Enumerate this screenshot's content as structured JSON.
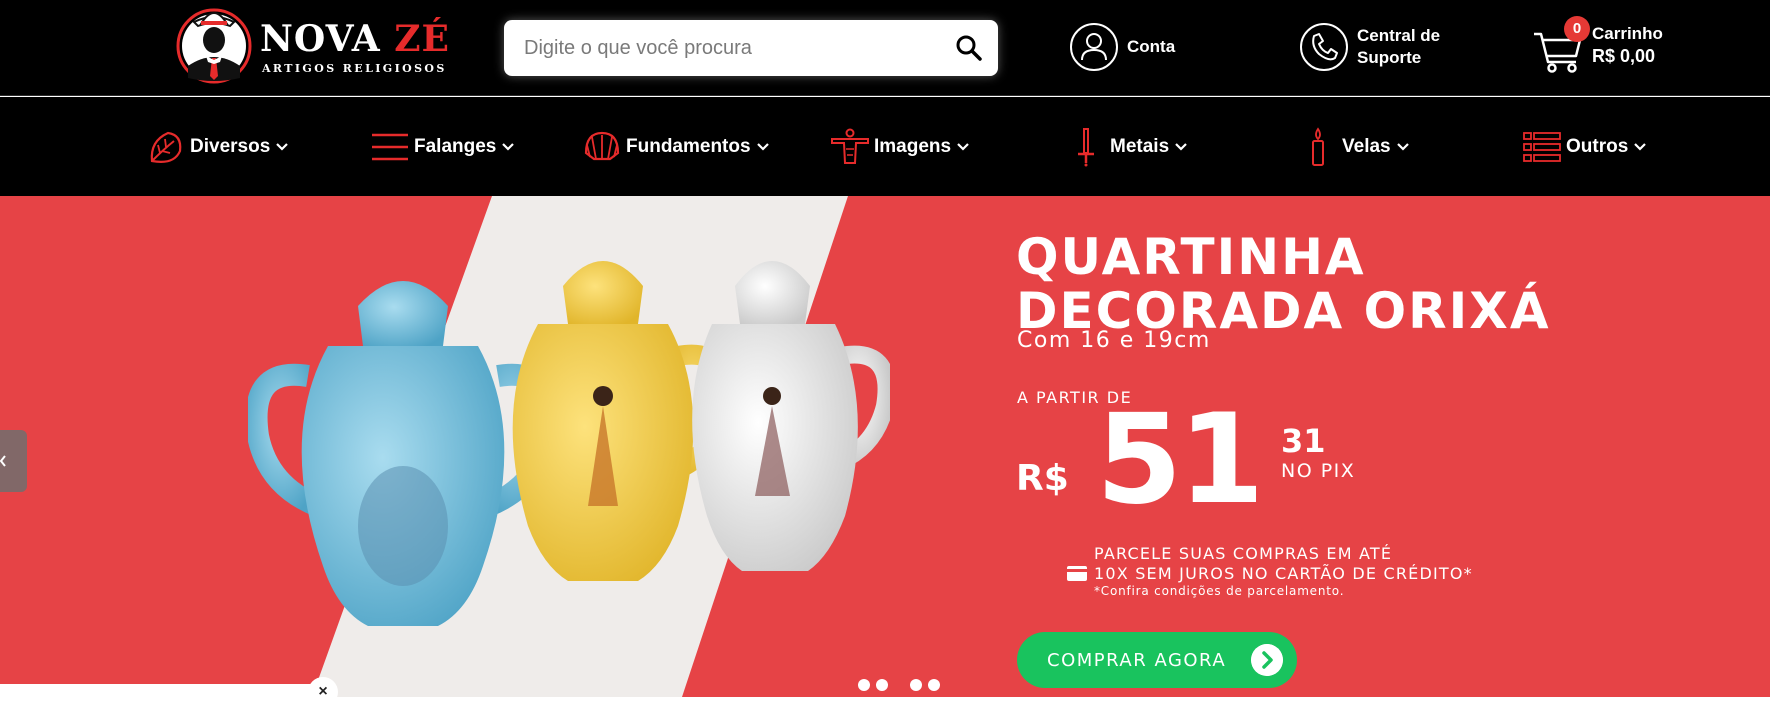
{
  "brand": {
    "name_main": "NOVA ",
    "name_accent": "ZÉ",
    "tagline": "ARTIGOS RELIGIOSOS"
  },
  "search": {
    "placeholder": "Digite o que você procura"
  },
  "header": {
    "account_label": "Conta",
    "support_line1": "Central de",
    "support_line2": "Suporte",
    "cart_label": "Carrinho",
    "cart_total": "R$ 0,00",
    "cart_count": "0"
  },
  "nav": {
    "items": [
      {
        "label": "Diversos",
        "icon": "leaf-icon"
      },
      {
        "label": "Falanges",
        "icon": "menu-lines-icon"
      },
      {
        "label": "Fundamentos",
        "icon": "shell-icon"
      },
      {
        "label": "Imagens",
        "icon": "christ-statue-icon"
      },
      {
        "label": "Metais",
        "icon": "sword-icon"
      },
      {
        "label": "Velas",
        "icon": "candle-icon"
      },
      {
        "label": "Outros",
        "icon": "list-icon"
      }
    ]
  },
  "hero": {
    "title_line1": "QUARTINHA",
    "title_line2": "DECORADA ORIXÁ",
    "subtitle": "Com 16 e 19cm",
    "from_label": "A PARTIR DE",
    "currency": "R$",
    "price_integer": "51",
    "price_cents": "31",
    "price_note": "NO PIX",
    "install_line1": "PARCELE SUAS COMPRAS EM ATÉ",
    "install_line2": "10X SEM JUROS NO CARTÃO DE CRÉDITO*",
    "install_note": "*Confira condições de parcelamento.",
    "cta_label": "COMPRAR AGORA",
    "slide_count": 4
  },
  "popup": {
    "close_glyph": "×"
  },
  "colors": {
    "header_bg": "#000000",
    "accent_red": "#e62b2b",
    "hero_red": "#e64346",
    "cta_green": "#19c35e"
  }
}
